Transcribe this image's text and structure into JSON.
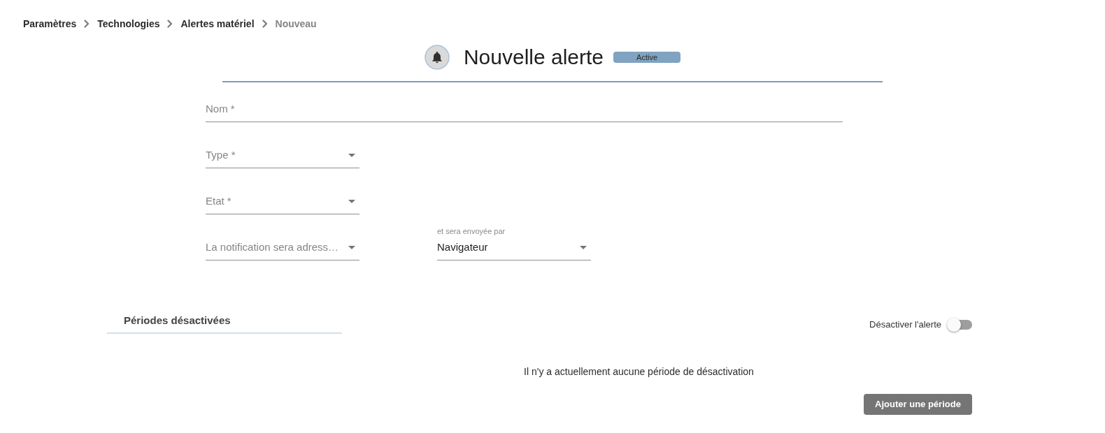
{
  "breadcrumb": [
    {
      "label": "Paramètres",
      "current": false
    },
    {
      "label": "Technologies",
      "current": false
    },
    {
      "label": "Alertes matériel",
      "current": false
    },
    {
      "label": "Nouveau",
      "current": true
    }
  ],
  "header": {
    "title": "Nouvelle alerte",
    "status_badge": "Active"
  },
  "form": {
    "fields": [
      {
        "kind": "text",
        "placeholder": "Nom *"
      },
      {
        "kind": "select",
        "placeholder": "Type *"
      },
      {
        "kind": "select",
        "placeholder": "Etat *"
      }
    ],
    "recipient_select": {
      "placeholder": "La notification sera adress…"
    },
    "channel_select": {
      "label": "et sera envoyée par",
      "value": "Navigateur"
    }
  },
  "disabled_periods": {
    "title": "Périodes désactivées",
    "toggle": {
      "label": "Désactiver l'alerte",
      "on": false
    },
    "empty_message": "Il n'y a actuellement aucune période de désactivation",
    "add_button": "Ajouter une période"
  }
}
